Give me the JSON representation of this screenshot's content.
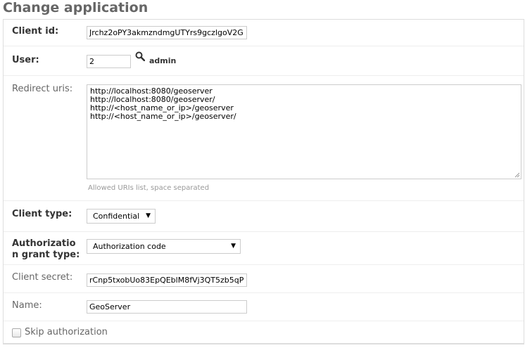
{
  "page": {
    "title": "Change application"
  },
  "client_id": {
    "label": "Client id:",
    "value": "Jrchz2oPY3akmzndmgUTYrs9gczlgoV2G"
  },
  "user": {
    "label": "User:",
    "value": "2",
    "lookup_icon": "magnifier-icon",
    "display_name": "admin"
  },
  "redirect_uris": {
    "label": "Redirect uris:",
    "lines": [
      "http://localhost:8080/geoserver",
      "http://localhost:8080/geoserver/",
      "http://<host_name_or_ip>/geoserver",
      "http://<host_name_or_ip>/geoserver/"
    ],
    "help": "Allowed URIs list, space separated"
  },
  "client_type": {
    "label": "Client type:",
    "value": "Confidential"
  },
  "grant_type": {
    "label_line1": "Authorizatio",
    "label_line2": "n grant type:",
    "value": "Authorization code"
  },
  "client_secret": {
    "label": "Client secret:",
    "value": "rCnp5txobUo83EpQEblM8fVj3QT5zb5qP"
  },
  "name": {
    "label": "Name:",
    "value": "GeoServer"
  },
  "skip_authorization": {
    "label": "Skip authorization",
    "checked": false
  }
}
